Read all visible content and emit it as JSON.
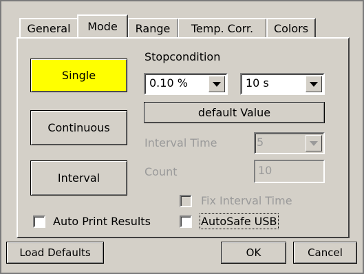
{
  "tabs": [
    "General",
    "Mode",
    "Range",
    "Temp. Corr.",
    "Colors"
  ],
  "active_tab": "Mode",
  "mode_buttons": {
    "single": "Single",
    "continuous": "Continuous",
    "interval": "Interval"
  },
  "mode_colors": {
    "single_active": "#ffff00"
  },
  "stopcondition": {
    "label": "Stopcondition",
    "percent_value": "0.10 %",
    "time_value": "10 s",
    "default_button": "default Value"
  },
  "interval_time": {
    "label": "Interval Time",
    "value": "5"
  },
  "count": {
    "label": "Count",
    "value": "10"
  },
  "checkboxes": {
    "fix_interval": "Fix Interval Time",
    "auto_print": "Auto Print Results",
    "autosafe_usb": "AutoSafe USB"
  },
  "footer": {
    "load_defaults": "Load Defaults",
    "ok": "OK",
    "cancel": "Cancel"
  }
}
